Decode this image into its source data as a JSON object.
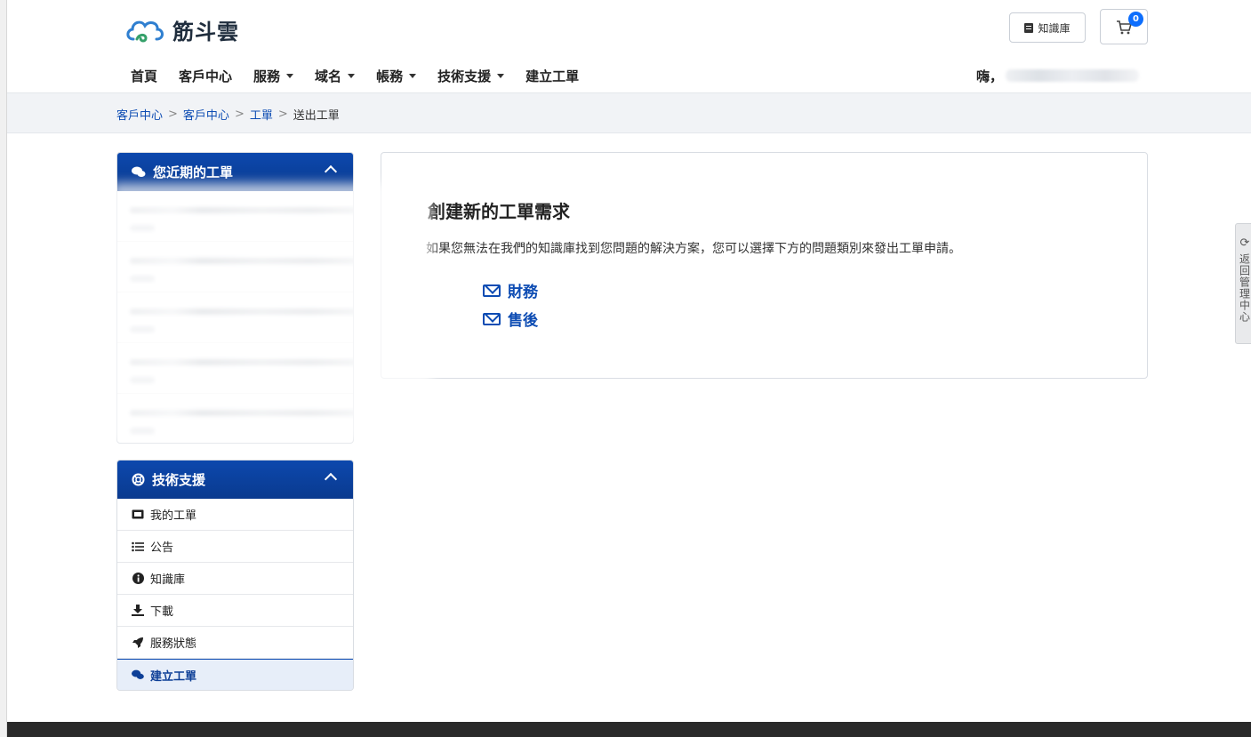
{
  "brand": {
    "name": "筋斗雲"
  },
  "header": {
    "kb_button": "知識庫",
    "cart_count": "0",
    "greeting": "嗨，"
  },
  "nav": {
    "items": [
      {
        "label": "首頁",
        "dropdown": false
      },
      {
        "label": "客戶中心",
        "dropdown": false
      },
      {
        "label": "服務",
        "dropdown": true
      },
      {
        "label": "域名",
        "dropdown": true
      },
      {
        "label": "帳務",
        "dropdown": true
      },
      {
        "label": "技術支援",
        "dropdown": true
      },
      {
        "label": "建立工單",
        "dropdown": false
      }
    ]
  },
  "breadcrumb": [
    {
      "label": "客戶中心",
      "link": true
    },
    {
      "label": "客戶中心",
      "link": true
    },
    {
      "label": "工單",
      "link": true
    },
    {
      "label": "送出工單",
      "link": false
    }
  ],
  "recent_panel": {
    "title": "您近期的工單",
    "item_count": 5
  },
  "support_panel": {
    "title": "技術支援",
    "items": [
      {
        "label": "我的工單",
        "icon": "ticket-icon"
      },
      {
        "label": "公告",
        "icon": "list-icon"
      },
      {
        "label": "知識庫",
        "icon": "info-icon"
      },
      {
        "label": "下載",
        "icon": "download-icon"
      },
      {
        "label": "服務狀態",
        "icon": "rocket-icon"
      },
      {
        "label": "建立工單",
        "icon": "comments-icon",
        "active": true
      }
    ]
  },
  "main": {
    "title": "創建新的工單需求",
    "description": "如果您無法在我們的知識庫找到您問題的解決方案，您可以選擇下方的問題類別來發出工單申請。",
    "departments": [
      {
        "label": "財務"
      },
      {
        "label": "售後"
      }
    ]
  },
  "side_tab": {
    "label": "返回管理中心"
  },
  "colors": {
    "primary": "#0d4cb3",
    "panel_header": "#0c48ad",
    "active_bg": "#e7eef9",
    "footer": "#2a2a2a"
  }
}
